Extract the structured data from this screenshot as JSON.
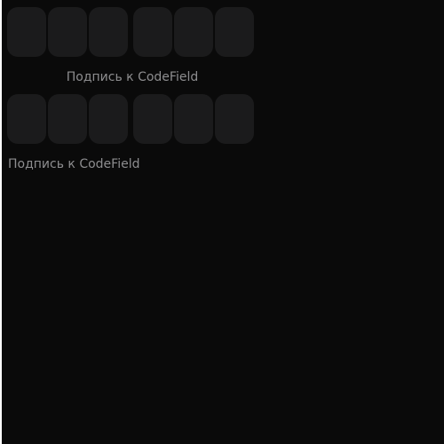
{
  "codefields": [
    {
      "id": "codefield-1",
      "caption": "Подпись к CodeField",
      "caption_align": "center"
    },
    {
      "id": "codefield-2",
      "caption": "Подпись к CodeField",
      "caption_align": "left"
    }
  ],
  "colors": {
    "background": "#0a0a0a",
    "cell": "#1b1b1c",
    "caption_text": "#8d8d8f"
  }
}
